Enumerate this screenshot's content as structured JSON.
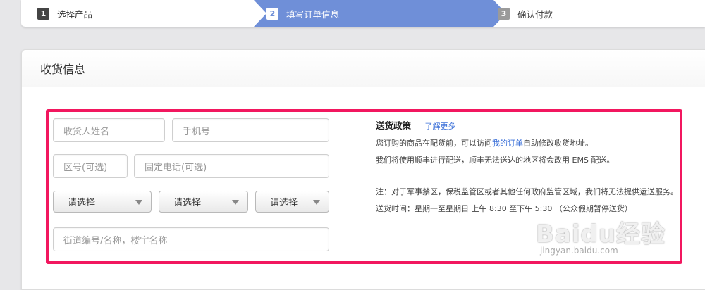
{
  "steps": [
    {
      "num": "1",
      "label": "选择产品"
    },
    {
      "num": "2",
      "label": "填写订单信息"
    },
    {
      "num": "3",
      "label": "确认付款"
    }
  ],
  "colors": {
    "active_step": "#6f8fd8",
    "highlight": "#f2175f",
    "link": "#3a6fd8"
  },
  "section": {
    "title": "收货信息"
  },
  "form": {
    "name_placeholder": "收货人姓名",
    "phone_placeholder": "手机号",
    "area_code_placeholder": "区号(可选)",
    "landline_placeholder": "固定电话(可选)",
    "select_province": "请选择",
    "select_city": "请选择",
    "select_district": "请选择",
    "street_placeholder": "街道编号/名称，楼宇名称"
  },
  "policy": {
    "title": "送货政策",
    "more_link": "了解更多",
    "line1_before": "您订购的商品在配货前，可以访问",
    "line1_link": "我的订单",
    "line1_after": "自助修改收货地址。",
    "line2": "我们将使用顺丰进行配送，顺丰无法送达的地区将会改用 EMS 配送。",
    "line3": "注：对于军事禁区，保税监管区或者其他任何政府监管区域，我们将无法提供运送服务。",
    "line4": "送货时间：星期一至星期日 上午 8:30 至下午 5:30 （公众假期暂停送货）"
  },
  "watermark": {
    "brand": "Baidu经验",
    "url": "jingyan.baidu.com"
  }
}
